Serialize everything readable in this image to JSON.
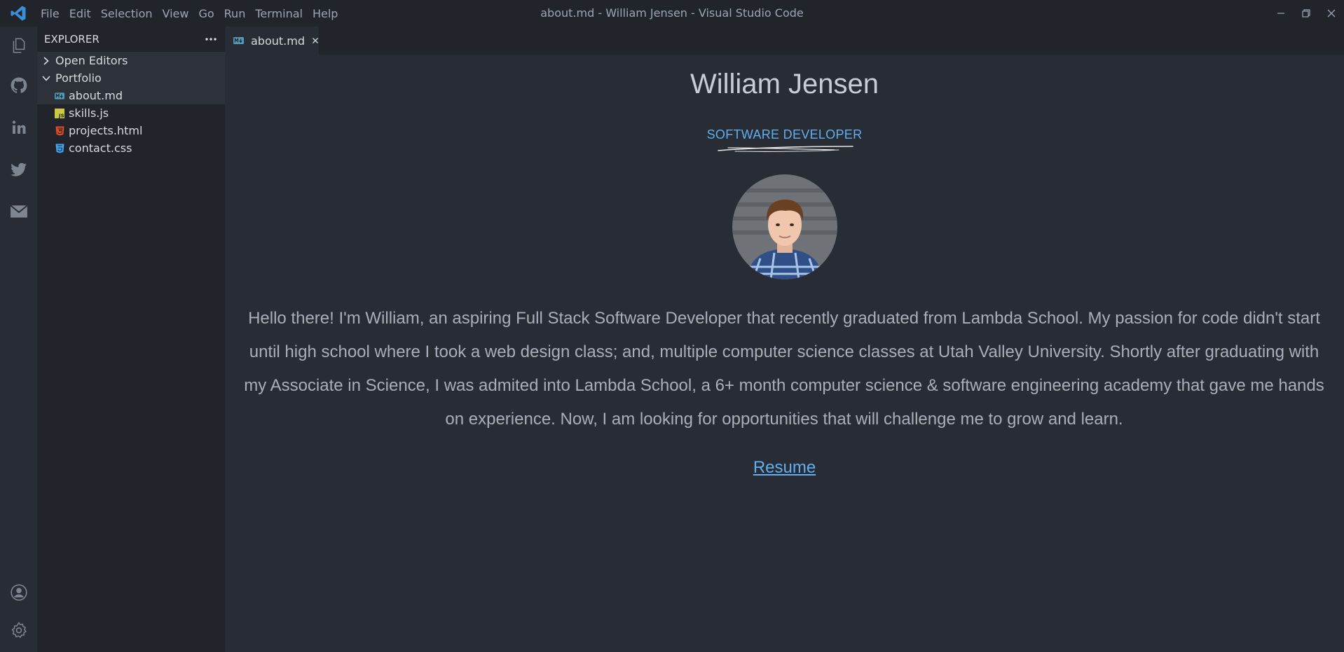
{
  "titlebar": {
    "menu": [
      "File",
      "Edit",
      "Selection",
      "View",
      "Go",
      "Run",
      "Terminal",
      "Help"
    ],
    "window_title": "about.md - William Jensen - Visual Studio Code"
  },
  "activitybar": {
    "icons": [
      "files-icon",
      "github-icon",
      "linkedin-icon",
      "twitter-icon",
      "mail-icon",
      "account-icon",
      "settings-gear-icon"
    ]
  },
  "sidebar": {
    "header": "EXPLORER",
    "open_editors": "Open Editors",
    "folder": "Portfolio",
    "files": [
      {
        "label": "about.md",
        "icon": "markdown-icon",
        "color": "#519aba"
      },
      {
        "label": "skills.js",
        "icon": "javascript-icon",
        "color": "#cbcb41"
      },
      {
        "label": "projects.html",
        "icon": "html-icon",
        "color": "#e34c26"
      },
      {
        "label": "contact.css",
        "icon": "css-icon",
        "color": "#42a5f5"
      }
    ]
  },
  "tab": {
    "label": "about.md"
  },
  "content": {
    "name": "William Jensen",
    "role": "SOFTWARE DEVELOPER",
    "bio": "Hello there! I'm William, an aspiring Full Stack Software Developer that recently graduated from Lambda School. My passion for code didn't start until high school where I took a web design class; and, multiple computer science classes at Utah Valley University. Shortly after graduating with my Associate in Science, I was admited into Lambda School, a 6+ month computer science & software engineering academy that gave me hands on experience. Now, I am looking for opportunities that will challenge me to grow and learn.",
    "resume": "Resume"
  },
  "colors": {
    "accent": "#61afef",
    "background": "#282c34",
    "sidebar": "#21252b"
  }
}
